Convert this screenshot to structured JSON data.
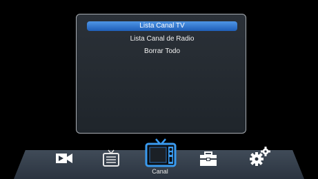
{
  "menu": {
    "items": [
      {
        "label": "Lista Canal TV",
        "selected": true
      },
      {
        "label": "Lista Canal de Radio",
        "selected": false
      },
      {
        "label": "Borrar Todo",
        "selected": false
      }
    ]
  },
  "bottom_bar": {
    "icons": [
      "video-camera-icon",
      "tv-list-icon",
      "tv-channel-icon",
      "toolbox-icon",
      "gears-icon"
    ],
    "active_label": "Canal"
  },
  "colors": {
    "selection": "#3a7fd6",
    "panel_border": "#a8adb3",
    "bar": "#3a4450"
  }
}
